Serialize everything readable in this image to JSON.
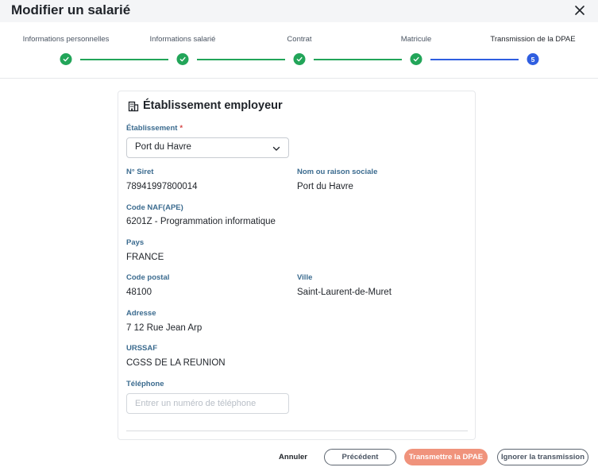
{
  "header": {
    "title": "Modifier un salarié"
  },
  "stepper": {
    "steps": [
      {
        "label": "Informations personnelles",
        "status": "done"
      },
      {
        "label": "Informations salarié",
        "status": "done"
      },
      {
        "label": "Contrat",
        "status": "done"
      },
      {
        "label": "Matricule",
        "status": "done"
      },
      {
        "label": "Transmission de la DPAE",
        "status": "current",
        "number": "5"
      }
    ]
  },
  "section": {
    "title": "Établissement employeur",
    "etablissement": {
      "label": "Établissement",
      "required_mark": "*",
      "value": "Port du Havre"
    },
    "siret": {
      "label": "N° Siret",
      "value": "78941997800014"
    },
    "raison_sociale": {
      "label": "Nom ou raison sociale",
      "value": "Port du Havre"
    },
    "naf": {
      "label": "Code NAF(APE)",
      "value": "6201Z - Programmation informatique"
    },
    "pays": {
      "label": "Pays",
      "value": "FRANCE"
    },
    "code_postal": {
      "label": "Code postal",
      "value": "48100"
    },
    "ville": {
      "label": "Ville",
      "value": "Saint-Laurent-de-Muret"
    },
    "adresse": {
      "label": "Adresse",
      "value": "7 12 Rue Jean Arp"
    },
    "urssaf": {
      "label": "URSSAF",
      "value": "CGSS DE LA REUNION"
    },
    "telephone": {
      "label": "Téléphone",
      "value": "",
      "placeholder": "Entrer un numéro de téléphone"
    }
  },
  "footer": {
    "cancel_label": "Annuler",
    "previous_label": "Précédent",
    "submit_label": "Transmettre la DPAE",
    "ignore_label": "Ignorer la transmission"
  },
  "colors": {
    "success": "#22a559",
    "active": "#2f5ee0",
    "label": "#3b6b8f",
    "primary_button": "#f0937c",
    "required": "#d64545"
  }
}
